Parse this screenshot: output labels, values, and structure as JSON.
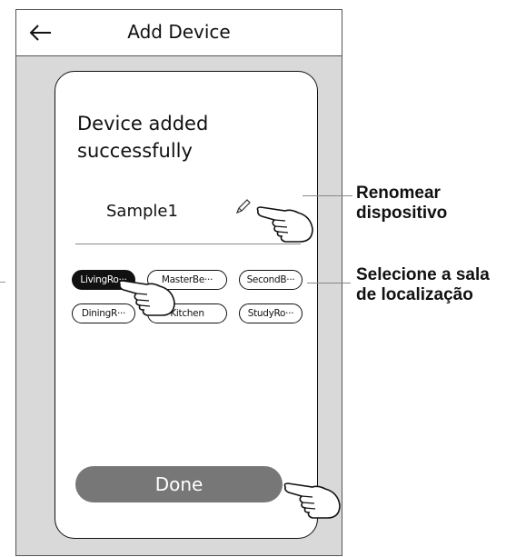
{
  "header": {
    "title": "Add Device"
  },
  "card": {
    "message": "Device added successfully",
    "device_name": "Sample1",
    "rooms": [
      {
        "label": "LivingRo···",
        "selected": true
      },
      {
        "label": "MasterBe···",
        "selected": false
      },
      {
        "label": "SecondB···",
        "selected": false
      },
      {
        "label": "DiningR···",
        "selected": false
      },
      {
        "label": "Kitchen",
        "selected": false
      },
      {
        "label": "StudyRo···",
        "selected": false
      }
    ],
    "done_label": "Done"
  },
  "annotations": {
    "rename": [
      "Renomear",
      "dispositivo"
    ],
    "select_room": [
      "Selecione a sala",
      "de localização"
    ]
  },
  "colors": {
    "panel_bg": "#d9d9d9",
    "done_button": "#777777",
    "selected_room": "#111111"
  }
}
